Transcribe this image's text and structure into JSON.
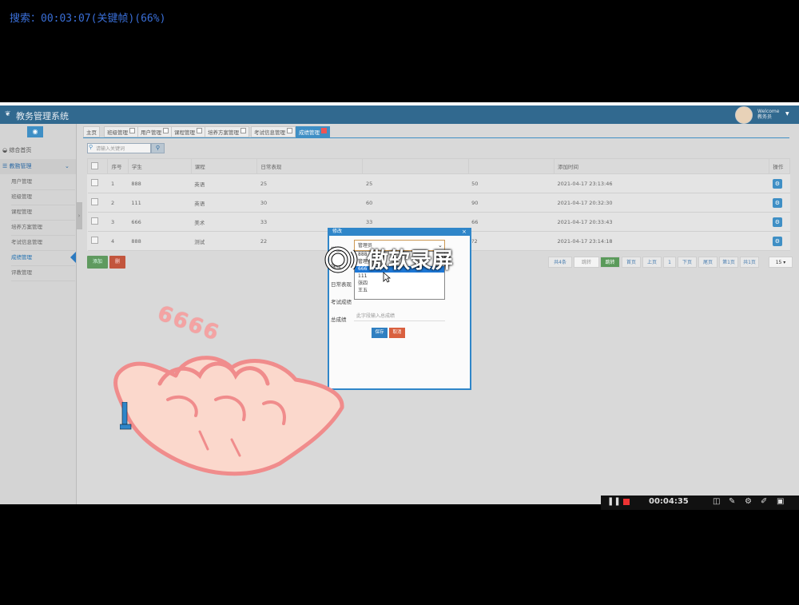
{
  "recording_label": "搜索：00:03:07(关键帧)(66%)",
  "header": {
    "title": "教务管理系统",
    "welcome": "Welcome",
    "username": "教务员"
  },
  "sidebar": {
    "items": [
      {
        "label": "综合首页"
      },
      {
        "label": "教務管理"
      }
    ],
    "subitems": [
      {
        "label": "用户管理"
      },
      {
        "label": "班级管理"
      },
      {
        "label": "课程管理"
      },
      {
        "label": "培养方案管理"
      },
      {
        "label": "考试信息管理"
      },
      {
        "label": "成绩管理",
        "active": true
      },
      {
        "label": "评教管理"
      }
    ]
  },
  "tabs": [
    {
      "label": "主页"
    },
    {
      "label": "班级管理"
    },
    {
      "label": "用户管理"
    },
    {
      "label": "课程管理"
    },
    {
      "label": "培养方案管理"
    },
    {
      "label": "考试信息管理"
    },
    {
      "label": "成绩管理",
      "active": true
    }
  ],
  "search": {
    "placeholder": "请输入关键词"
  },
  "table": {
    "headers": [
      "",
      "序号",
      "学生",
      "课程",
      "日常表现",
      "",
      "",
      "添加时间",
      "操作"
    ],
    "rows": [
      {
        "no": "1",
        "student": "888",
        "course": "英语",
        "daily": "25",
        "exam": "25",
        "total": "50",
        "time": "2021-04-17 23:13:46"
      },
      {
        "no": "2",
        "student": "111",
        "course": "英语",
        "daily": "30",
        "exam": "60",
        "total": "90",
        "time": "2021-04-17 20:32:30"
      },
      {
        "no": "3",
        "student": "666",
        "course": "美术",
        "daily": "33",
        "exam": "33",
        "total": "66",
        "time": "2021-04-17 20:33:43"
      },
      {
        "no": "4",
        "student": "888",
        "course": "测试",
        "daily": "22",
        "exam": "",
        "total": "?2",
        "time": "2021-04-17 23:14:18"
      }
    ]
  },
  "toolbar": {
    "add_label": "添加",
    "delete_label": "删"
  },
  "pager": {
    "total": "共4条",
    "goto_input": "跳转",
    "goto_button": "跳转",
    "first": "首页",
    "prev": "上页",
    "current": "1",
    "next": "下页",
    "last": "尾页",
    "page_of": "第1页",
    "pages": "共1页",
    "page_size": "15"
  },
  "dialog": {
    "title": "修改",
    "close": "×",
    "student_label": "学生",
    "course_label": "课程",
    "daily_label": "日常表现",
    "exam_label": "考试成绩",
    "total_label": "总成绩",
    "student_selected": "管理员",
    "options": [
      "888",
      "管理员",
      "666",
      "111",
      "张四",
      "王五"
    ],
    "selected_option": "666",
    "total_placeholder": "此字段输入总成绩",
    "save_label": "保存",
    "cancel_label": "取消"
  },
  "watermark": {
    "text": "傲软录屏"
  },
  "sticker": {
    "text": "6666"
  },
  "taskbar": {
    "timer": "00:04:35"
  }
}
